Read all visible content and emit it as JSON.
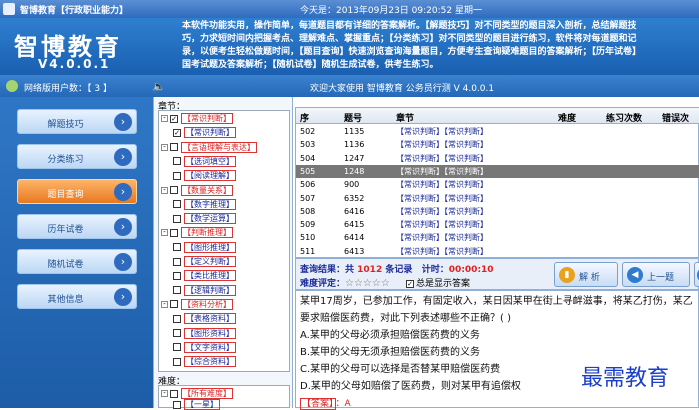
{
  "window": {
    "title": "智博教育【行政职业能力】",
    "date_text": "今天是：2013年09月23日   09:20:52    星期一"
  },
  "header": {
    "logo": "智博教育",
    "version": "V4.0.0.1",
    "intro_lines": [
      "本软件功能实用，操作简单，每道题目都有详细的答案解析。【解题技巧】对不同类型的题目深入剖析，总结解题技",
      "巧，力求短时间内把握考点、理解难点、掌握重点；【分类练习】对不同类型的题目进行练习，软件将对每道题和记",
      "录，以便考生轻松做题时间，【题目查询】快速浏览查询海量题目，方便考生查询疑难题目的答案解析；【历年试卷】",
      "国考试题及答案解析；【随机试卷】随机生成试卷，供考生练习。"
    ]
  },
  "status": {
    "users_label": "网络版用户数：【 3 】",
    "speaker_icon": "speaker-icon",
    "welcome": "欢迎大家使用 智博教育 公务员行测 V 4.0.0.1"
  },
  "nav": [
    {
      "label": "解题技巧",
      "active": false
    },
    {
      "label": "分类练习",
      "active": false
    },
    {
      "label": "题目查询",
      "active": true
    },
    {
      "label": "历年试卷",
      "active": false
    },
    {
      "label": "随机试卷",
      "active": false
    },
    {
      "label": "其他信息",
      "active": false
    }
  ],
  "chapters": {
    "label": "章节：",
    "tree": [
      {
        "text": "【常识判断】",
        "level": 0,
        "expander": "-",
        "checked": true,
        "red": true
      },
      {
        "text": "【常识判断】",
        "level": 1,
        "expander": "",
        "checked": true,
        "red": false
      },
      {
        "text": "【言语理解与表达】",
        "level": 0,
        "expander": "-",
        "checked": false,
        "red": true
      },
      {
        "text": "【选词填空】",
        "level": 1,
        "expander": "",
        "checked": false,
        "red": false
      },
      {
        "text": "【阅读理解】",
        "level": 1,
        "expander": "",
        "checked": false,
        "red": false
      },
      {
        "text": "【数量关系】",
        "level": 0,
        "expander": "-",
        "checked": false,
        "red": true
      },
      {
        "text": "【数字推理】",
        "level": 1,
        "expander": "",
        "checked": false,
        "red": false
      },
      {
        "text": "【数学运算】",
        "level": 1,
        "expander": "",
        "checked": false,
        "red": false
      },
      {
        "text": "【判断推理】",
        "level": 0,
        "expander": "-",
        "checked": false,
        "red": true
      },
      {
        "text": "【图形推理】",
        "level": 1,
        "expander": "",
        "checked": false,
        "red": false
      },
      {
        "text": "【定义判断】",
        "level": 1,
        "expander": "",
        "checked": false,
        "red": false
      },
      {
        "text": "【类比推理】",
        "level": 1,
        "expander": "",
        "checked": false,
        "red": false
      },
      {
        "text": "【逻辑判断】",
        "level": 1,
        "expander": "",
        "checked": false,
        "red": false
      },
      {
        "text": "【资料分析】",
        "level": 0,
        "expander": "-",
        "checked": false,
        "red": true
      },
      {
        "text": "【表格资料】",
        "level": 1,
        "expander": "",
        "checked": false,
        "red": false
      },
      {
        "text": "【图形资料】",
        "level": 1,
        "expander": "",
        "checked": false,
        "red": false
      },
      {
        "text": "【文字资料】",
        "level": 1,
        "expander": "",
        "checked": false,
        "red": false
      },
      {
        "text": "【综合资料】",
        "level": 1,
        "expander": "",
        "checked": false,
        "red": false
      }
    ],
    "difficulty_label": "难度：",
    "difficulty_tree": [
      {
        "text": "【所有难度】",
        "level": 0,
        "expander": "-",
        "checked": false,
        "red": true
      },
      {
        "text": "【一星】",
        "level": 1,
        "expander": "",
        "checked": false,
        "red": false
      }
    ]
  },
  "table": {
    "columns": [
      "序",
      "题号",
      "章节",
      "难度",
      "练习次数",
      "错误次"
    ],
    "rows": [
      {
        "seq": "502",
        "id": "1135",
        "chapter": "【常识判断】【常识判断】",
        "selected": false
      },
      {
        "seq": "503",
        "id": "1136",
        "chapter": "【常识判断】【常识判断】",
        "selected": false
      },
      {
        "seq": "504",
        "id": "1247",
        "chapter": "【常识判断】【常识判断】",
        "selected": false
      },
      {
        "seq": "505",
        "id": "1248",
        "chapter": "【常识判断】【常识判断】",
        "selected": true
      },
      {
        "seq": "506",
        "id": "900",
        "chapter": "【常识判断】【常识判断】",
        "selected": false
      },
      {
        "seq": "507",
        "id": "6352",
        "chapter": "【常识判断】【常识判断】",
        "selected": false
      },
      {
        "seq": "508",
        "id": "6416",
        "chapter": "【常识判断】【常识判断】",
        "selected": false
      },
      {
        "seq": "509",
        "id": "6415",
        "chapter": "【常识判断】【常识判断】",
        "selected": false
      },
      {
        "seq": "510",
        "id": "6414",
        "chapter": "【常识判断】【常识判断】",
        "selected": false
      },
      {
        "seq": "511",
        "id": "6413",
        "chapter": "【常识判断】【常识判断】",
        "selected": false
      }
    ]
  },
  "result": {
    "prefix": "查询结果：共",
    "count": "1012",
    "suffix": "条记录",
    "timer_label": "计时：",
    "timer": "00:00:10",
    "difficulty_label": "难度评定：",
    "stars": "☆☆☆☆☆",
    "show_answer": "总是显示答案",
    "parse_button": "解 析",
    "prev_button": "上一题"
  },
  "question": {
    "stem": "某甲17周岁，已参加工作，有固定收入，某日因某甲在街上寻衅滋事，将某乙打伤，某乙要求赔偿医药费，对此下列表述哪些不正确？(      )",
    "options": [
      "A.某甲的父母必须承担赔偿医药费的义务",
      "B.某甲的父母无须承担赔偿医药费的义务",
      "C.某甲的父母可以选择是否替某甲赔偿医药费",
      "D.某甲的父母如赔偿了医药费，则对某甲有追偿权"
    ],
    "answer_label": "【答案】",
    "answer": "：A"
  },
  "watermark": "最需教育"
}
